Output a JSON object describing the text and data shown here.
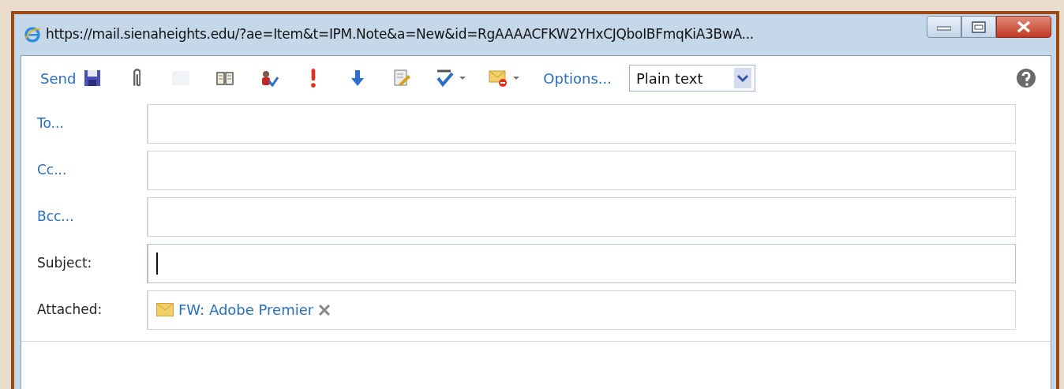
{
  "window": {
    "title": "https://mail.sienaheights.edu/?ae=Item&t=IPM.Note&a=New&id=RgAAAACFKW2YHxCJQboIBFmqKiA3BwA..."
  },
  "toolbar": [
    {
      "kind": "link",
      "label": "Send"
    },
    {
      "kind": "icon",
      "disabled": false
    },
    {
      "kind": "icon",
      "disabled": false
    },
    {
      "kind": "icon",
      "disabled": true
    },
    {
      "kind": "icon",
      "disabled": false
    },
    {
      "kind": "icon",
      "disabled": false
    },
    {
      "kind": "icon",
      "disabled": false
    },
    {
      "kind": "icon",
      "disabled": false
    },
    {
      "kind": "icon",
      "disabled": false
    },
    {
      "kind": "icon-menu",
      "disabled": false
    },
    {
      "kind": "icon-menu",
      "disabled": false
    },
    {
      "kind": "link",
      "label": "Options..."
    },
    {
      "kind": "select",
      "value": "Plain text"
    }
  ],
  "fields": [
    {
      "kind": "link",
      "label": "To...",
      "focused": false
    },
    {
      "kind": "link",
      "label": "Cc...",
      "focused": false
    },
    {
      "kind": "link",
      "label": "Bcc...",
      "focused": false
    },
    {
      "kind": "label",
      "label": "Subject:",
      "focused": true
    },
    {
      "kind": "attachments",
      "label": "Attached:",
      "focused": false,
      "attachments": [
        {
          "name": "FW: Adobe Premier"
        }
      ]
    }
  ]
}
